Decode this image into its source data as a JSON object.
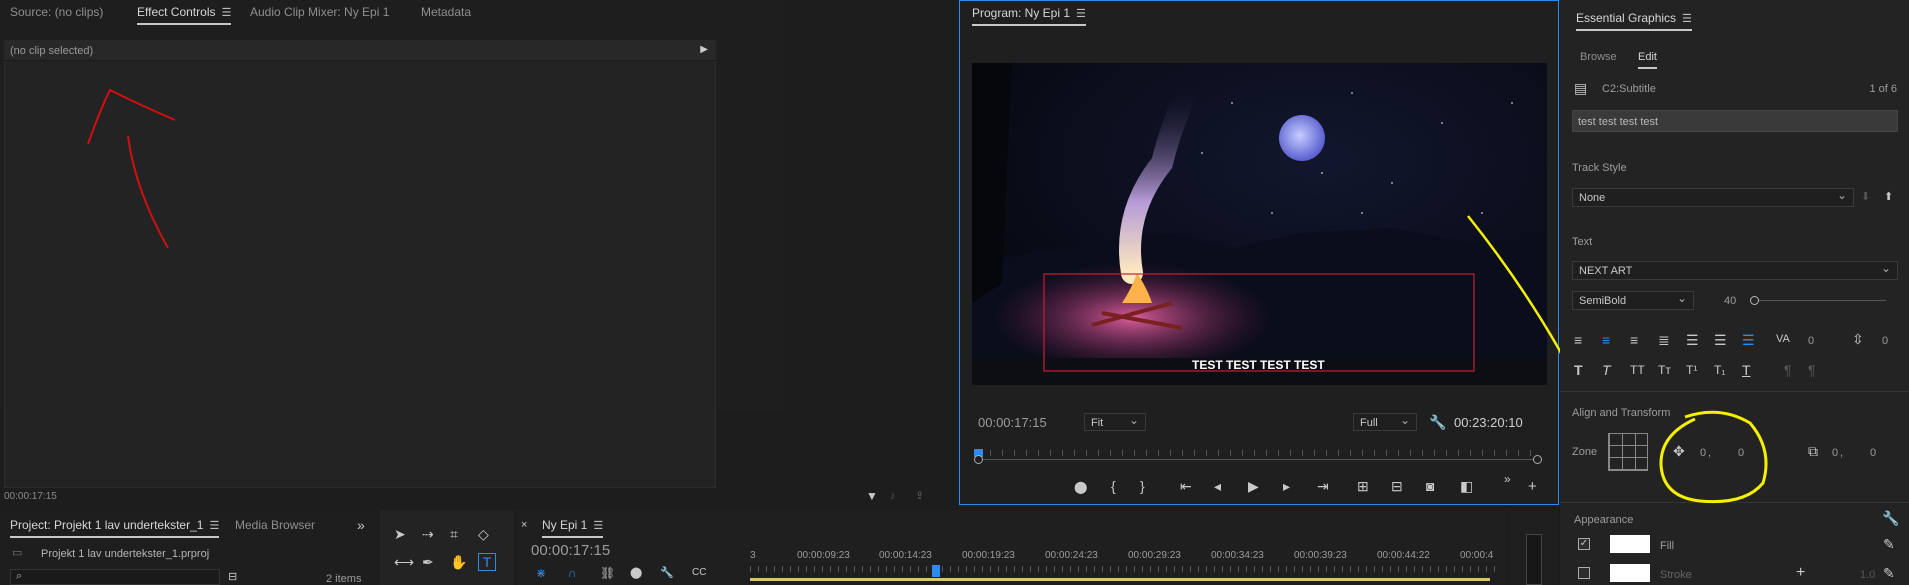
{
  "source_panel": {
    "tabs": [
      "Source: (no clips)",
      "Effect Controls",
      "Audio Clip Mixer: Ny Epi 1",
      "Metadata"
    ],
    "no_clip": "(no clip selected)",
    "timecode": "00:00:17:15"
  },
  "program": {
    "title": "Program: Ny Epi 1",
    "subtitle_text": "TEST TEST TEST TEST",
    "current_time": "00:00:17:15",
    "fit": "Fit",
    "quality": "Full",
    "duration": "00:23:20:10"
  },
  "essential_graphics": {
    "title": "Essential Graphics",
    "tabs": [
      "Browse",
      "Edit"
    ],
    "layer_name": "C2:Subtitle",
    "layer_count": "1 of 6",
    "text_value": "test test test test",
    "track_style_label": "Track Style",
    "track_style_value": "None",
    "text_section": "Text",
    "font": "NEXT ART",
    "font_style": "SemiBold",
    "font_size": "40",
    "font_size_fraction": 0.0,
    "kerning": "0",
    "leading": "0",
    "align_section": "Align and Transform",
    "zone_label": "Zone",
    "pos_x": "0",
    "pos_y": "0",
    "scale_x": "0",
    "scale_y": "0",
    "appearance_label": "Appearance",
    "fill_label": "Fill",
    "stroke_label": "Stroke",
    "stroke_width": "1.0"
  },
  "project": {
    "tabs": [
      "Project: Projekt 1 lav undertekster_1",
      "Media Browser"
    ],
    "file": "Projekt 1 lav undertekster_1.prproj",
    "items": "2 items"
  },
  "timeline": {
    "tab": "Ny Epi 1",
    "current_time": "00:00:17:15",
    "ruler": [
      "3",
      "00:00:09:23",
      "00:00:14:23",
      "00:00:19:23",
      "00:00:24:23",
      "00:00:29:23",
      "00:00:34:23",
      "00:00:39:23",
      "00:00:44:22",
      "00:00:4"
    ]
  },
  "colors": {
    "accent": "#2d8ceb",
    "annotation_yellow": "#f5f000",
    "annotation_red": "#d01010"
  }
}
